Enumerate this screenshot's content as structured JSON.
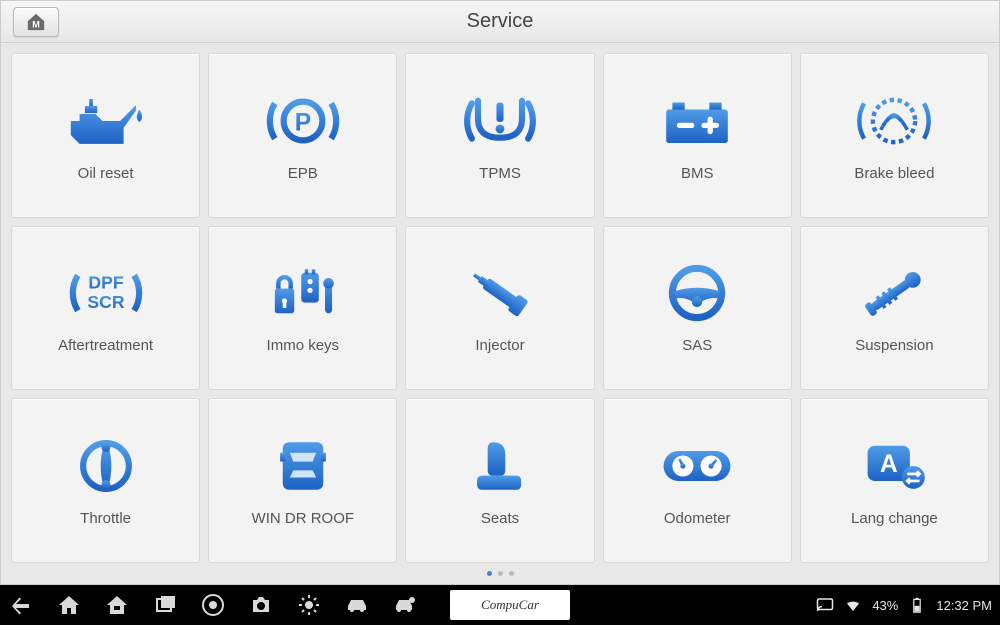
{
  "header": {
    "title": "Service"
  },
  "tiles": [
    {
      "label": "Oil reset",
      "icon": "oil-can-icon"
    },
    {
      "label": "EPB",
      "icon": "parking-brake-icon"
    },
    {
      "label": "TPMS",
      "icon": "tpms-icon"
    },
    {
      "label": "BMS",
      "icon": "battery-icon"
    },
    {
      "label": "Brake bleed",
      "icon": "brake-bleed-icon"
    },
    {
      "label": "Aftertreatment",
      "icon": "dpf-scr-icon"
    },
    {
      "label": "Immo keys",
      "icon": "immo-keys-icon"
    },
    {
      "label": "Injector",
      "icon": "injector-icon"
    },
    {
      "label": "SAS",
      "icon": "steering-wheel-icon"
    },
    {
      "label": "Suspension",
      "icon": "suspension-icon"
    },
    {
      "label": "Throttle",
      "icon": "throttle-icon"
    },
    {
      "label": "WIN DR ROOF",
      "icon": "car-top-icon"
    },
    {
      "label": "Seats",
      "icon": "seat-icon"
    },
    {
      "label": "Odometer",
      "icon": "odometer-icon"
    },
    {
      "label": "Lang change",
      "icon": "language-icon"
    }
  ],
  "pager": {
    "pages": 3,
    "active": 0
  },
  "navbar": {
    "watermark": "CompuCar",
    "battery_pct": "43%",
    "clock": "12:32 PM"
  }
}
